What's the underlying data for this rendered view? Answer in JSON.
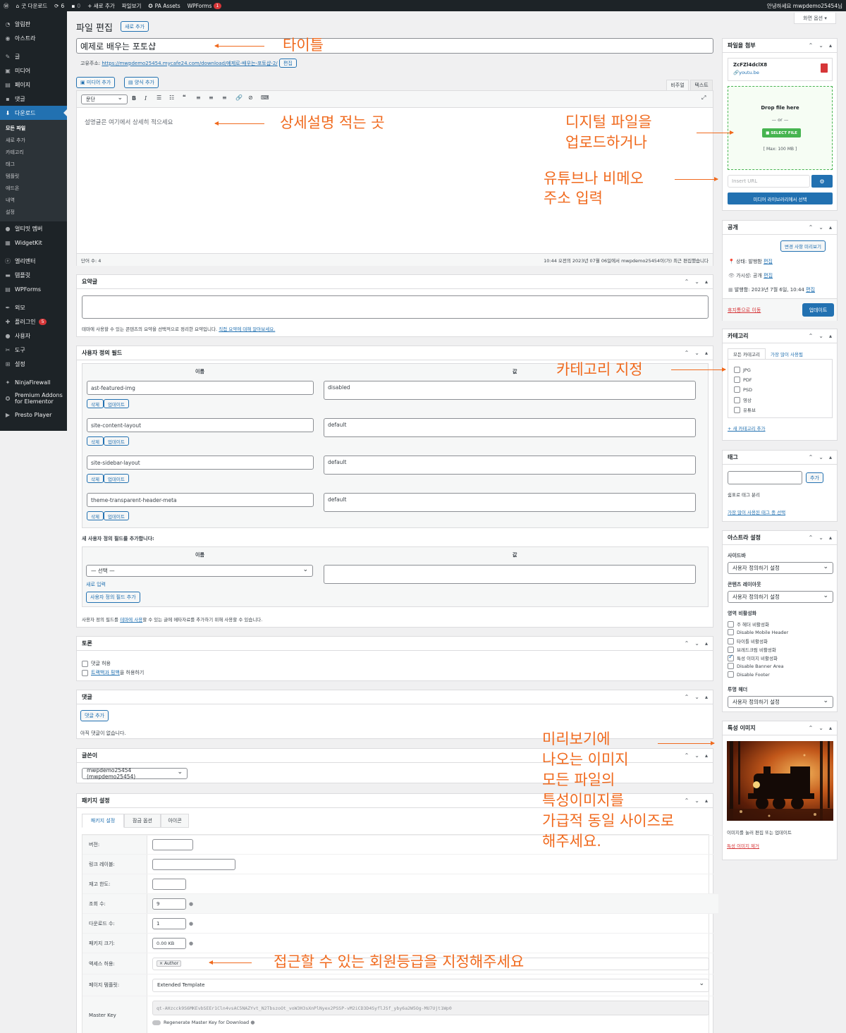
{
  "adminbar": {
    "site": "굿 다운로드",
    "updates": "6",
    "comments": "0",
    "new": "+ 새로 추가",
    "filebox": "파일보기",
    "pa_assets": "PA Assets",
    "wpforms": "WPForms",
    "wpforms_badge": "1",
    "greeting": "안녕하세요 mwpdemo25454님"
  },
  "screen_options": "화면 옵션",
  "sidebar": {
    "items": [
      {
        "label": "알림판",
        "icon": "dashboard-icon"
      },
      {
        "label": "아스트라",
        "icon": "astra-icon"
      },
      {
        "label": "글",
        "icon": "pin-icon"
      },
      {
        "label": "미디어",
        "icon": "media-icon"
      },
      {
        "label": "페이지",
        "icon": "page-icon"
      },
      {
        "label": "댓글",
        "icon": "comment-icon"
      },
      {
        "label": "다운로드",
        "icon": "download-icon"
      }
    ],
    "submenu": [
      "모든 파일",
      "새로 추가",
      "카테고리",
      "태그",
      "템플릿",
      "애드온",
      "내역",
      "설정"
    ],
    "items2": [
      {
        "label": "얼티밋 멤버",
        "icon": "user-icon"
      },
      {
        "label": "WidgetKit",
        "icon": "widget-icon"
      },
      {
        "label": "엘리멘터",
        "icon": "elementor-icon"
      },
      {
        "label": "템플릿",
        "icon": "folder-icon"
      },
      {
        "label": "WPForms",
        "icon": "form-icon"
      },
      {
        "label": "외모",
        "icon": "brush-icon"
      },
      {
        "label": "플러그인",
        "icon": "plugin-icon",
        "badge": "5"
      },
      {
        "label": "사용자",
        "icon": "user-icon"
      },
      {
        "label": "도구",
        "icon": "wrench-icon"
      },
      {
        "label": "설정",
        "icon": "settings-icon"
      },
      {
        "label": "NinjaFirewall",
        "icon": "ninja-icon"
      },
      {
        "label": "Premium Addons for Elementor",
        "icon": "addons-icon"
      },
      {
        "label": "Presto Player",
        "icon": "play-icon"
      }
    ]
  },
  "header": {
    "title": "파일 편집",
    "add_new": "새로 추가"
  },
  "post": {
    "title": "예제로 배우는 포토샵",
    "permalink_label": "고유주소:",
    "permalink": "https://mwpdemo25454.mycafe24.com/download/예제로-배우는-포토샵-2/",
    "edit": "편집"
  },
  "editor": {
    "add_media": "미디어 추가",
    "add_form": "양식 추가",
    "tab_visual": "비주얼",
    "tab_text": "텍스트",
    "format": "문단",
    "content": "설명글은 여기에서 상세히 적으세요",
    "wordcount": "단어 수: 4",
    "lastedit": "10:44 오전의 2023년 07월 06일에서 mwpdemo25454이(가) 최근 편집했습니다"
  },
  "excerpt": {
    "title": "요약글",
    "help_prefix": "테마에 사용할 수 있는 콘텐츠의 요약을 선택적으로 정리한 요약입니다.",
    "help_link": "직접 요약에 대해 알아보세요."
  },
  "custom_fields": {
    "title": "사용자 정의 필드",
    "col_name": "이름",
    "col_value": "값",
    "rows": [
      {
        "name": "ast-featured-img",
        "value": "disabled"
      },
      {
        "name": "site-content-layout",
        "value": "default"
      },
      {
        "name": "site-sidebar-layout",
        "value": "default"
      },
      {
        "name": "theme-transparent-header-meta",
        "value": "default"
      }
    ],
    "delete": "삭제",
    "update": "업데이트",
    "add_title": "새 사용자 정의 필드를 추가합니다:",
    "select": "— 선택 —",
    "enter_new": "새로 입력",
    "add_button": "사용자 정의 필드 추가",
    "help_prefix": "사용자 정의 필드를",
    "help_link": "테마에 사용",
    "help_suffix": "할 수 있는 글에 메타자료를 추가하기 위해 사용할 수 있습니다."
  },
  "discussion": {
    "title": "토론",
    "allow_comments": "댓글 허용",
    "trackback_link": "트랙백과 핑백",
    "trackback_suffix": "을 허용하기"
  },
  "comments": {
    "title": "댓글",
    "add": "댓글 추가",
    "none": "아직 댓글이 없습니다."
  },
  "author": {
    "title": "글쓴이",
    "value": "mwpdemo25454 (mwpdemo25454)"
  },
  "package": {
    "title": "패키지 설정",
    "tabs": [
      "패키지 설정",
      "잠금 옵션",
      "아이콘"
    ],
    "rows": {
      "version": "버전:",
      "link_label": "링크 레이블:",
      "stock": "재고 한도:",
      "views": "조회 수:",
      "views_val": "9",
      "downloads": "다운로드 수:",
      "downloads_val": "1",
      "size": "패키지 크기:",
      "size_val": "0.00 KB",
      "access": "액세스 허용:",
      "access_val": "Author",
      "template": "페이지 템플릿:",
      "template_val": "Extended Template",
      "masterkey": "Master Key",
      "masterkey_val": "qt-AHzcck9S6MKEvbSEEr1Cln4vsAC5NAZYvt_N2TbszoOt_voW3H3sXnPlNyex2PSSP-vM2iCD3D4SyflJSf_yby6a2W5Og-MU7Ujt1Wp0",
      "regen": "Regenerate Master Key for Download"
    }
  },
  "attach": {
    "title": "파일을 첨부",
    "file": "ZcFZl4dclX8",
    "file_src": "youtu.be",
    "drop": "Drop file here",
    "or": "— or —",
    "select": "SELECT FILE",
    "max": "[ Max: 100 MB ]",
    "url_placeholder": "Insert URL",
    "media_lib": "미디어 라이브러리에서 선택"
  },
  "publish": {
    "title": "공개",
    "preview": "변경 사항 미리보기",
    "status": "상태: 발행함",
    "status_edit": "편집",
    "visibility": "가시성: 공개",
    "visibility_edit": "편집",
    "published": "발행함: 2023년 7월 6일, 10:44",
    "published_edit": "편집",
    "trash": "휴지통으로 이동",
    "update": "업데이트"
  },
  "category": {
    "title": "카테고리",
    "tab_all": "모든 카테고리",
    "tab_popular": "가장 많이 사용됨",
    "items": [
      "JPG",
      "PDF",
      "PSD",
      "영상",
      "유튜브"
    ],
    "add": "+ 새 카테고리 추가"
  },
  "tags": {
    "title": "태그",
    "add": "추가",
    "help": "쉼표로 태그 분리",
    "popular": "가장 많이 사용된 태그 중 선택"
  },
  "astra": {
    "title": "아스트라 설정",
    "sidebar_label": "사이드바",
    "sidebar_val": "사용자 정의하기 설정",
    "content_label": "콘텐츠 레이아웃",
    "content_val": "사용자 정의하기 설정",
    "disable_label": "영역 비활성화",
    "options": [
      {
        "label": "주 헤더 비활성화",
        "on": false
      },
      {
        "label": "Disable Mobile Header",
        "on": false
      },
      {
        "label": "타이틀 비활성화",
        "on": false
      },
      {
        "label": "브레드크럼 비활성화",
        "on": false
      },
      {
        "label": "특성 이미지 비활성화",
        "on": true
      },
      {
        "label": "Disable Banner Area",
        "on": false
      },
      {
        "label": "Disable Footer",
        "on": false
      }
    ],
    "transparent_label": "투명 헤더",
    "transparent_val": "사용자 정의하기 설정"
  },
  "featured": {
    "title": "특성 이미지",
    "help": "이미지를 눌러 편집 또는 업데이트",
    "remove": "특성 이미지 제거"
  },
  "annotations": {
    "title": "타이틀",
    "desc": "상세설명 적는 곳",
    "upload": [
      "디지털 파일을",
      "업로드하거나"
    ],
    "youtube": [
      "유튜브나 비메오",
      "주소 입력"
    ],
    "category": "카테고리 지정",
    "preview": [
      "미리보기에",
      "나오는 이미지",
      "모든 파일의",
      "특성이미지를",
      "가급적 동일 사이즈로",
      "해주세요."
    ],
    "access": "접근할 수 있는 회원등급을 지정해주세요"
  },
  "colors": {
    "admin_dark": "#1d2327",
    "accent": "#2271b1",
    "annotation": "#f06a1e",
    "green": "#46b450"
  }
}
